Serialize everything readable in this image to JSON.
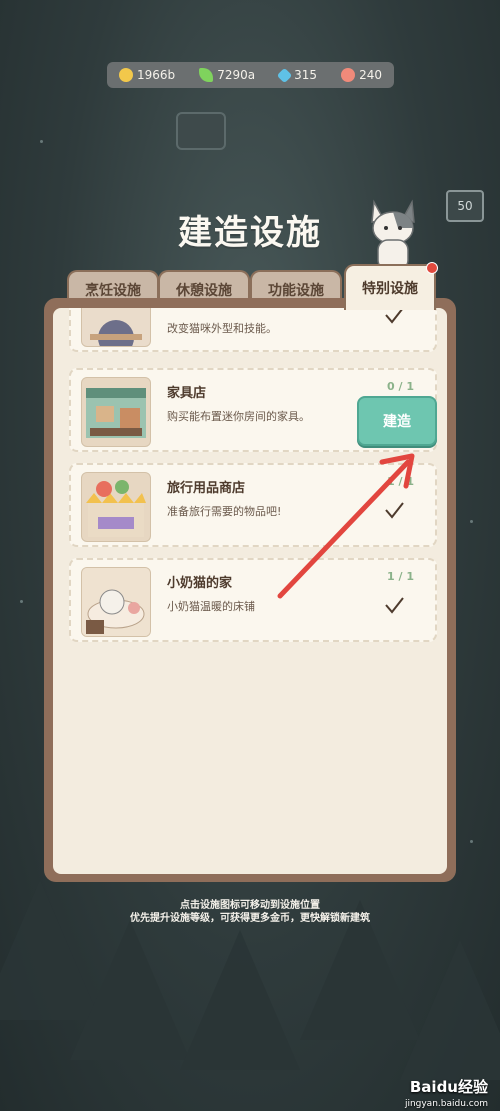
{
  "resources": [
    {
      "icon": "gold-coin-icon",
      "value": "1966b",
      "color": "#f2c84b"
    },
    {
      "icon": "leaf-icon",
      "value": "7290a",
      "color": "#7fd35d"
    },
    {
      "icon": "gem-icon",
      "value": "315",
      "color": "#5fc1e6"
    },
    {
      "icon": "fish-icon",
      "value": "240",
      "color": "#f08a7a"
    }
  ],
  "title": "建造设施",
  "tabs": [
    {
      "label": "烹饪设施"
    },
    {
      "label": "休憩设施"
    },
    {
      "label": "功能设施"
    },
    {
      "label": "特别设施"
    }
  ],
  "items": [
    {
      "name": "",
      "desc": "改变猫咪外型和技能。",
      "count": "",
      "state": "done"
    },
    {
      "name": "家具店",
      "desc": "购买能布置迷你房间的家具。",
      "count": "0 / 1",
      "state": "build",
      "build_label": "建造"
    },
    {
      "name": "旅行用品商店",
      "desc": "准备旅行需要的物品吧!",
      "count": "1 / 1",
      "state": "done"
    },
    {
      "name": "小奶猫的家",
      "desc": "小奶猫温暖的床铺",
      "count": "1 / 1",
      "state": "done"
    }
  ],
  "hints": [
    "点击设施图标可移动到设施位置",
    "优先提升设施等级，可获得更多金币，更快解锁新建筑"
  ],
  "sign_number": "50",
  "watermark": {
    "brand": "Baidu经验",
    "url": "jingyan.baidu.com"
  }
}
